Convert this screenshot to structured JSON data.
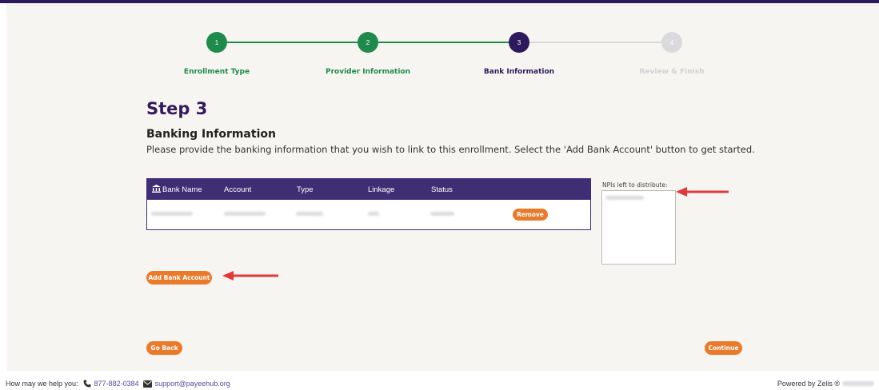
{
  "steps": [
    {
      "number": "1",
      "label": "Enrollment Type",
      "state": "complete"
    },
    {
      "number": "2",
      "label": "Provider Information",
      "state": "complete"
    },
    {
      "number": "3",
      "label": "Bank Information",
      "state": "current"
    },
    {
      "number": "4",
      "label": "Review & Finish",
      "state": "upcoming"
    }
  ],
  "colors": {
    "complete": "#1f8a4c",
    "current": "#2d1a5c",
    "upcoming": "#d9d9de",
    "accent": "#ea7a2b",
    "header": "#3f2e74"
  },
  "page": {
    "title": "Step 3",
    "subtitle": "Banking Information",
    "description": "Please provide the banking information that you wish to link to this enrollment. Select the 'Add Bank Account' button to get started."
  },
  "table": {
    "headers": [
      "Bank Name",
      "Account",
      "Type",
      "Linkage",
      "Status"
    ],
    "remove_label": "Remove"
  },
  "npi": {
    "label": "NPIs left to distribute:"
  },
  "buttons": {
    "add_bank": "Add Bank Account",
    "go_back": "Go Back",
    "continue": "Continue"
  },
  "footer": {
    "help_text": "How may we help you:",
    "phone": "877-882-0384",
    "email": "support@payeehub.org",
    "powered_by": "Powered by Zelis ®"
  }
}
